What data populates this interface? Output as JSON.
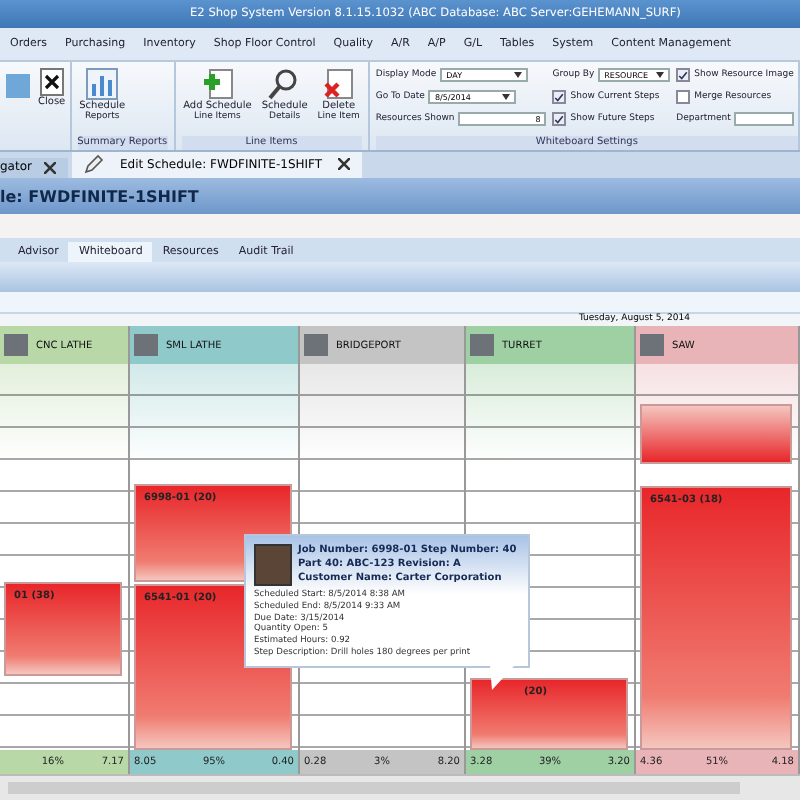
{
  "window": {
    "title": "E2 Shop System Version 8.1.15.1032 (ABC Database: ABC Server:GEHEMANN_SURF)"
  },
  "menu": [
    "Orders",
    "Purchasing",
    "Inventory",
    "Shop Floor Control",
    "Quality",
    "A/R",
    "A/P",
    "G/L",
    "Tables",
    "System",
    "Content Management"
  ],
  "ribbon": {
    "close_label": "Close",
    "groups": [
      {
        "label": "Summary Reports",
        "buttons": [
          {
            "kind": "report",
            "lines": [
              "Schedule",
              "Reports"
            ]
          }
        ]
      },
      {
        "label": "Line Items",
        "buttons": [
          {
            "kind": "add",
            "lines": [
              "Add Schedule",
              "Line Items"
            ]
          },
          {
            "kind": "details",
            "lines": [
              "Schedule",
              "Details"
            ]
          },
          {
            "kind": "delete",
            "lines": [
              "Delete",
              "Line Item"
            ]
          }
        ]
      }
    ],
    "settings": {
      "label": "Whiteboard Settings",
      "fields": [
        {
          "label": "Display Mode",
          "value": "DAY",
          "kind": "select"
        },
        {
          "label": "Go To Date",
          "value": "8/5/2014",
          "kind": "select"
        },
        {
          "label": "Resources Shown",
          "value": "8",
          "kind": "spin"
        }
      ],
      "group_by": {
        "label": "Group By",
        "value": "RESOURCE"
      },
      "checks": [
        {
          "label": "Show Current Steps",
          "checked": true
        },
        {
          "label": "Show Future Steps",
          "checked": true
        }
      ],
      "checks2": [
        {
          "label": "Show Resource Image",
          "checked": true
        },
        {
          "label": "Merge Resources",
          "checked": false
        }
      ],
      "department": {
        "label": "Department"
      }
    }
  },
  "doc_tabs": [
    {
      "label": "gator",
      "selected": false
    },
    {
      "label": "Edit Schedule: FWDFINITE-1SHIFT",
      "selected": true
    }
  ],
  "header": "le: FWDFINITE-1SHIFT",
  "tabs": [
    {
      "label": "Advisor",
      "selected": false
    },
    {
      "label": "Whiteboard",
      "selected": true
    },
    {
      "label": "Resources",
      "selected": false
    },
    {
      "label": "Audit Trail",
      "selected": false
    }
  ],
  "date": "Tuesday, August 5, 2014",
  "resources": [
    {
      "name": "CNC LATHE",
      "color": "#b9d8a8",
      "jobs": [
        {
          "label": "01 (38)"
        }
      ],
      "stats": {
        "percent": "16%",
        "end": "7.17"
      }
    },
    {
      "name": "SML LATHE",
      "color": "#8fc9c9",
      "jobs": [
        {
          "label": "6998-01 (20)"
        },
        {
          "label": "6541-01 (20)"
        }
      ],
      "stats": {
        "start": "8.05",
        "percent": "95%",
        "end": "0.40"
      }
    },
    {
      "name": "BRIDGEPORT",
      "color": "#c4c4c4",
      "stats": {
        "start": "0.28",
        "percent": "3%",
        "end": "8.20"
      }
    },
    {
      "name": "TURRET",
      "color": "#9fd0a4",
      "jobs": [
        {
          "label": "(20)"
        }
      ],
      "stats": {
        "start": "3.28",
        "percent": "39%",
        "end": "3.20"
      }
    },
    {
      "name": "SAW",
      "color": "#e8b4b8",
      "jobs": [
        {
          "kind": "overflow"
        },
        {
          "label": "6541-03 (18)"
        }
      ],
      "stats": {
        "start": "4.36",
        "percent": "51%",
        "end": "4.18"
      }
    }
  ],
  "tooltip": {
    "title_lines": [
      "Job Number: 6998-01 Step Number: 40",
      "Part 40: ABC-123 Revision: A",
      "Customer Name: Carter Corporation"
    ],
    "details": [
      "Scheduled Start: 8/5/2014 8:38 AM",
      "Scheduled End: 8/5/2014 9:33 AM",
      "Due Date: 3/15/2014",
      "Quantity Open: 5",
      "Estimated Hours: 0.92",
      "Step Description: Drill holes 180 degrees per print"
    ]
  }
}
